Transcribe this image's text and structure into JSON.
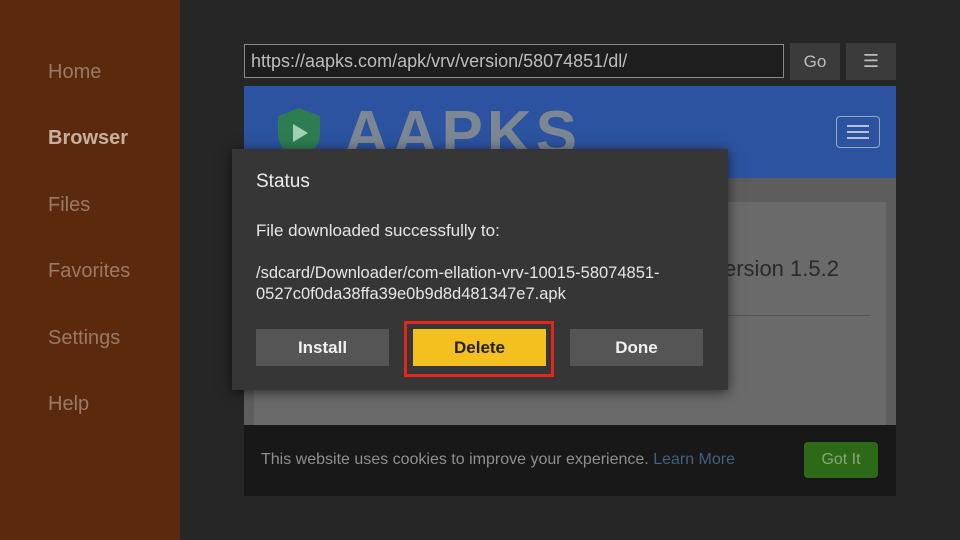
{
  "sidebar": {
    "items": [
      {
        "label": "Home"
      },
      {
        "label": "Browser"
      },
      {
        "label": "Files"
      },
      {
        "label": "Favorites"
      },
      {
        "label": "Settings"
      },
      {
        "label": "Help"
      }
    ],
    "active": "Browser"
  },
  "toolbar": {
    "url": "https://aapks.com/apk/vrv/version/58074851/dl/",
    "go_label": "Go",
    "menu_icon": "menu-icon"
  },
  "webpage": {
    "brand": "AAPKS",
    "version_text": "ersion 1.5.2",
    "cookie": {
      "text": "This website uses cookies to improve your experience.",
      "link": "Learn More",
      "button": "Got It"
    }
  },
  "dialog": {
    "title": "Status",
    "message": "File downloaded successfully to:",
    "path": "/sdcard/Downloader/com-ellation-vrv-10015-58074851-0527c0f0da38ffa39e0b9d8d481347e7.apk",
    "buttons": {
      "install": "Install",
      "delete": "Delete",
      "done": "Done"
    }
  },
  "colors": {
    "sidebar_bg": "#5b2a0c",
    "accent_yellow": "#f3c01f",
    "highlight_red": "#e2261b",
    "site_header_blue": "#2c53a0",
    "cookie_button_green": "#2d6a17"
  }
}
